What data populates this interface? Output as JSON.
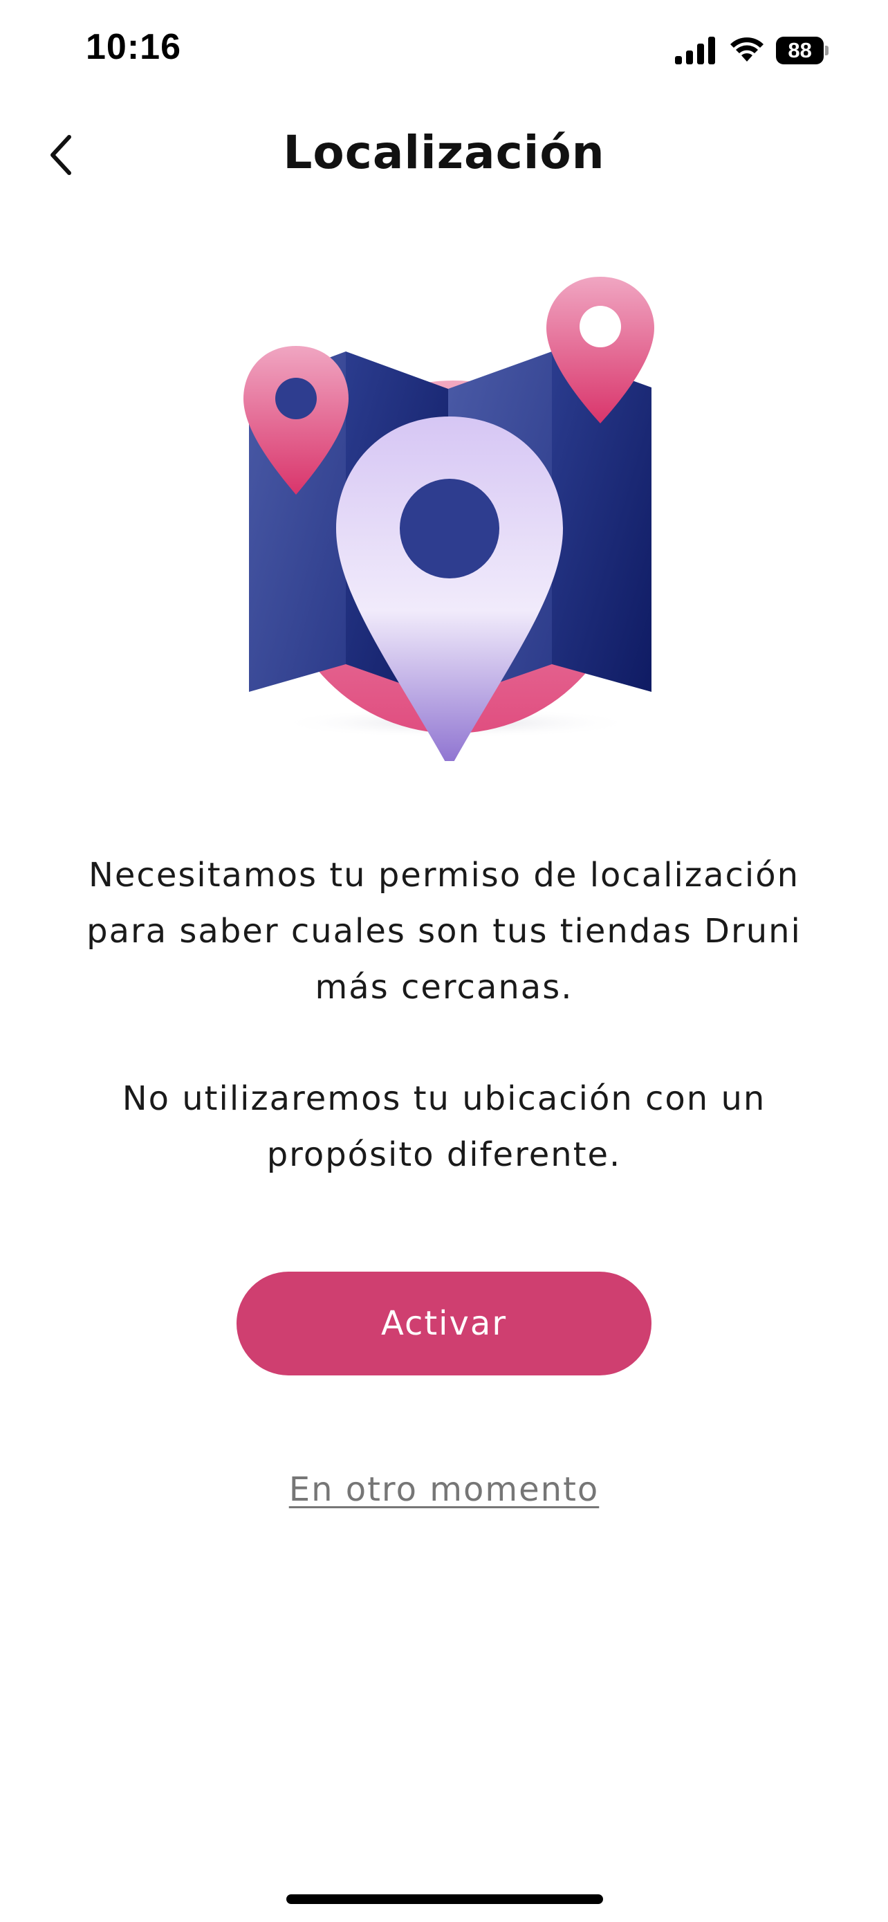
{
  "status_bar": {
    "time": "10:16",
    "battery_level": "88",
    "icons": [
      "signal-icon",
      "wifi-icon",
      "battery-icon"
    ]
  },
  "header": {
    "title": "Localización",
    "back_icon": "chevron-left-icon"
  },
  "illustration": {
    "name": "map-location-illustration",
    "colors": {
      "map_dark": "#1e2a78",
      "map_light": "#3a4a9a",
      "pin_pink": "#e0507f",
      "pin_lavender": "#c9b8f0",
      "circle_pink": "#e66a93"
    }
  },
  "content": {
    "message_line_1": "Necesitamos tu permiso de localización",
    "message_line_2": "para saber cuales son tus tiendas Druni",
    "message_line_3": "más cercanas.",
    "secondary_line_1": "No utilizaremos tu ubicación con un",
    "secondary_line_2": "propósito diferente."
  },
  "actions": {
    "primary_label": "Activar",
    "secondary_label": "En otro momento"
  },
  "colors": {
    "accent": "#cf3f70",
    "link": "#767676",
    "text": "#1a1a1a"
  }
}
